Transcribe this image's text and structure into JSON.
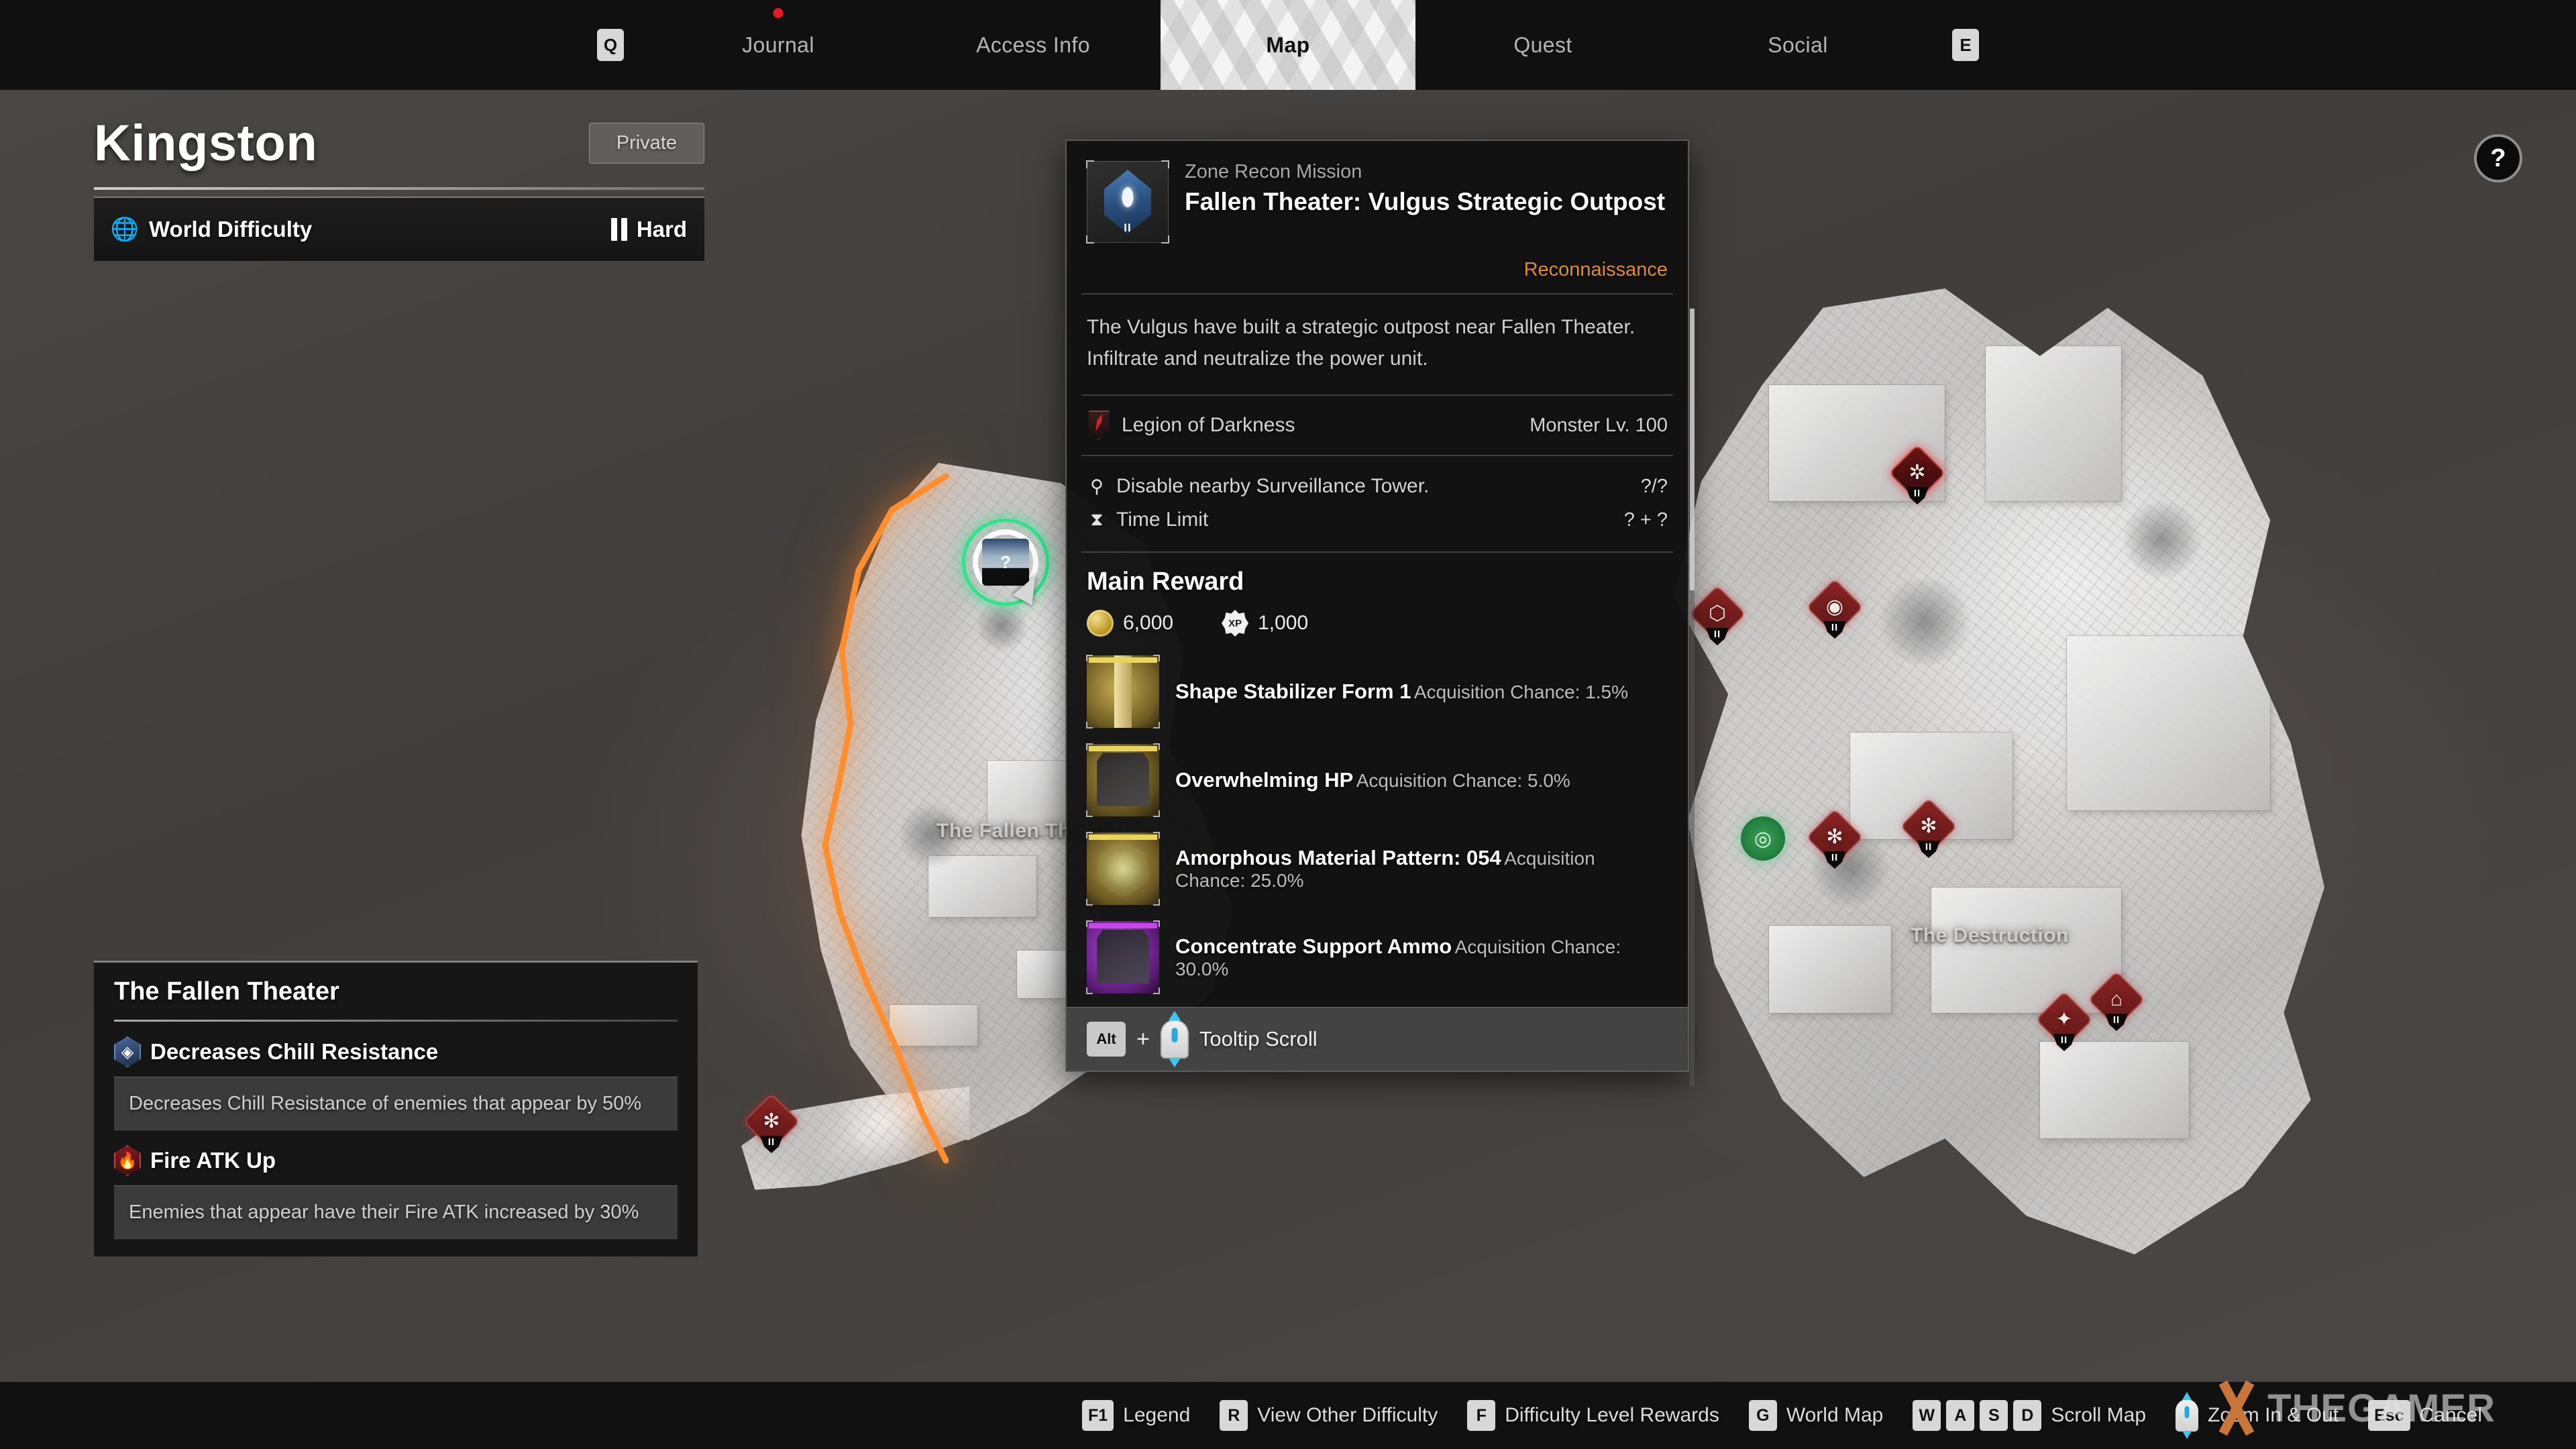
{
  "topnav": {
    "left_key": "Q",
    "right_key": "E",
    "tabs": [
      {
        "label": "Journal",
        "active": false,
        "has_notification": true
      },
      {
        "label": "Access Info",
        "active": false,
        "has_notification": false
      },
      {
        "label": "Map",
        "active": true,
        "has_notification": false
      },
      {
        "label": "Quest",
        "active": false,
        "has_notification": false
      },
      {
        "label": "Social",
        "active": false,
        "has_notification": false
      }
    ]
  },
  "header": {
    "title": "Kingston",
    "privacy": "Private",
    "difficulty_label": "World Difficulty",
    "difficulty_value": "Hard",
    "difficulty_tier": 2
  },
  "help_button": {
    "label": "?"
  },
  "map": {
    "labels": [
      {
        "text": "The Fallen Theater"
      },
      {
        "text": "The Destruction"
      }
    ],
    "selected_marker": {
      "tier": "II",
      "glyph": "?"
    }
  },
  "effects_panel": {
    "title": "The Fallen Theater",
    "effects": [
      {
        "name": "Decreases Chill Resistance",
        "description": "Decreases Chill Resistance of enemies that appear by 50%",
        "icon": "chill-hex-icon",
        "color": "#4a6a9e"
      },
      {
        "name": "Fire ATK Up",
        "description": "Enemies that appear have their Fire ATK increased by 30%",
        "icon": "fire-hex-icon",
        "color": "#d7232e"
      }
    ]
  },
  "tooltip": {
    "kicker": "Zone Recon Mission",
    "title": "Fallen Theater: Vulgus Strategic Outpost",
    "mission_type": "Reconnaissance",
    "type_color": "#e08b2c",
    "icon_tier": "II",
    "description": "The Vulgus have built a strategic outpost near Fallen Theater. Infiltrate and neutralize the power unit.",
    "faction": "Legion of Darkness",
    "monster_level": "Monster Lv. 100",
    "objectives": [
      {
        "icon": "person-pin-icon",
        "text": "Disable nearby Surveillance Tower.",
        "value": "?/?"
      },
      {
        "icon": "hourglass-icon",
        "text": "Time Limit",
        "value": "? + ?"
      }
    ],
    "reward_header": "Main Reward",
    "currency": [
      {
        "icon": "gold-coin-icon",
        "value": "6,000"
      },
      {
        "icon": "xp-badge-icon",
        "value": "1,000",
        "badge": "XP"
      }
    ],
    "items": [
      {
        "name": "Shape Stabilizer Form 1",
        "chance": "Acquisition Chance: 1.5%",
        "rarity_color": "#e8d55a",
        "thumb": "cartridge-thumb"
      },
      {
        "name": "Overwhelming HP",
        "chance": "Acquisition Chance: 5.0%",
        "rarity_color": "#e8d55a",
        "thumb": "module-card-thumb"
      },
      {
        "name": "Amorphous Material Pattern: 054",
        "chance": "Acquisition Chance: 25.0%",
        "rarity_color": "#e8d55a",
        "thumb": "crystal-thumb"
      },
      {
        "name": "Concentrate Support Ammo",
        "chance": "Acquisition Chance: 30.0%",
        "rarity_color": "#c746e8",
        "thumb": "module-card-purple-thumb"
      }
    ],
    "footer": {
      "key": "Alt",
      "plus": "+",
      "scroll_icon": "mouse-scroll-icon",
      "label": "Tooltip Scroll"
    }
  },
  "bottombar": {
    "hints": [
      {
        "keys": [
          "F1"
        ],
        "label": "Legend"
      },
      {
        "keys": [
          "R"
        ],
        "label": "View Other Difficulty"
      },
      {
        "keys": [
          "F"
        ],
        "label": "Difficulty Level Rewards"
      },
      {
        "keys": [
          "G"
        ],
        "label": "World Map"
      },
      {
        "keys": [
          "W",
          "A",
          "S",
          "D"
        ],
        "label": "Scroll Map"
      },
      {
        "keys": [],
        "icon": "mouse-scroll-icon",
        "label": "Zoom In & Out"
      },
      {
        "keys": [
          "Esc"
        ],
        "label": "Cancel"
      }
    ]
  },
  "watermark": {
    "text": "THEGAMER"
  }
}
